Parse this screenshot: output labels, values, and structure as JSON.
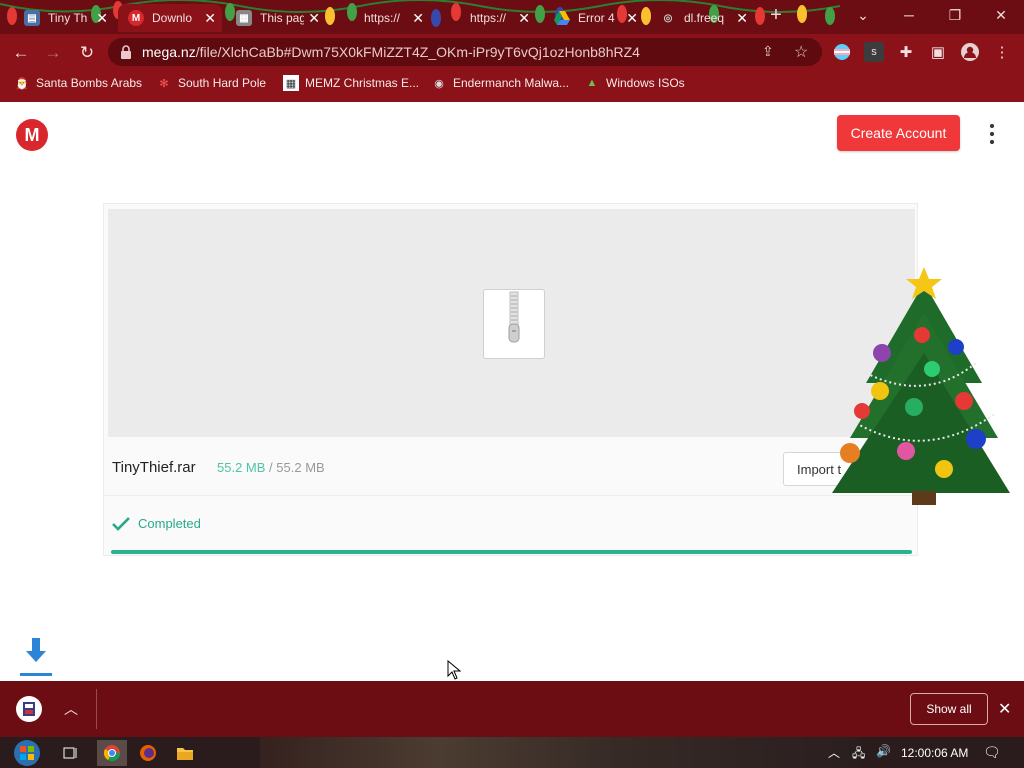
{
  "tabs": [
    {
      "title": "Tiny Th",
      "icon": "document-icon",
      "color": "#4a6fa5"
    },
    {
      "title": "Downlo",
      "icon": "mega-icon",
      "color": "#d9272e",
      "active": true
    },
    {
      "title": "This pag",
      "icon": "broken-page-icon",
      "color": "#888888"
    },
    {
      "title": "https://",
      "icon": "globe-icon",
      "color": "#888888"
    },
    {
      "title": "https://",
      "icon": "globe-icon",
      "color": "#888888"
    },
    {
      "title": "Error 4",
      "icon": "drive-icon",
      "color": "#f4b400"
    },
    {
      "title": "dl.freeq",
      "icon": "globe-icon",
      "color": "#888888"
    }
  ],
  "address": {
    "host": "mega.nz",
    "path": "/file/XlchCaBb#Dwm75X0kFMiZZT4Z_OKm-iPr9yT6vQj1ozHonb8hRZ4"
  },
  "bookmarks": [
    {
      "label": "Santa Bombs Arabs",
      "icon": "santa-icon"
    },
    {
      "label": "South Hard Pole",
      "icon": "snowflake-icon"
    },
    {
      "label": "MEMZ Christmas E...",
      "icon": "memz-icon"
    },
    {
      "label": "Endermanch Malwa...",
      "icon": "raccoon-icon"
    },
    {
      "label": "Windows ISOs",
      "icon": "tree-icon"
    }
  ],
  "header": {
    "logo": "M",
    "create_account": "Create Account"
  },
  "file": {
    "name": "TinyThief.rar",
    "downloaded": "55.2 MB",
    "separator": "/",
    "total": "55.2 MB",
    "import_label": "Import t",
    "status": "Completed",
    "progress": 1.0
  },
  "shelf": {
    "show_all": "Show all"
  },
  "taskbar": {
    "clock": "12:00:06 AM"
  },
  "colors": {
    "frame": "#8a1218",
    "tabstrip": "#6b0d12",
    "mega_red": "#f0373a",
    "progress": "#2bb38b"
  }
}
